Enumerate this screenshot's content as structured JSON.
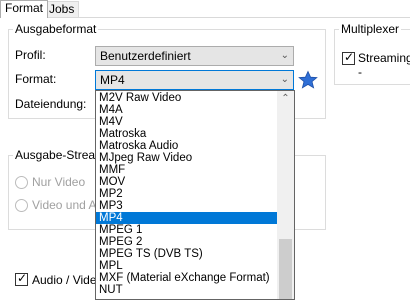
{
  "tabs": [
    {
      "label": "Format"
    },
    {
      "label": "Jobs"
    }
  ],
  "output_format": {
    "title": "Ausgabeformat",
    "profile_label": "Profil:",
    "profile_value": "Benutzerdefiniert",
    "format_label": "Format:",
    "format_value": "MP4",
    "file_ext_label": "Dateiendung:"
  },
  "multiplexer": {
    "title": "Multiplexer",
    "streaming_label": "Streaming -",
    "streaming_checked": true
  },
  "output_stream": {
    "title": "Ausgabe-Stream",
    "only_video_label": "Nur Video",
    "video_audio_label": "Video und Au"
  },
  "audio_video": {
    "label": "Audio / Video",
    "checked": true
  },
  "format_dropdown": {
    "selected": "MP4",
    "items": [
      "M2V Raw Video",
      "M4A",
      "M4V",
      "Matroska",
      "Matroska Audio",
      "MJpeg Raw Video",
      "MMF",
      "MOV",
      "MP2",
      "MP3",
      "MP4",
      "MPEG 1",
      "MPEG 2",
      "MPEG TS (DVB TS)",
      "MPL",
      "MXF (Material eXchange Format)",
      "NUT"
    ]
  },
  "colors": {
    "selection": "#0078d7",
    "star": "#2f6fd6"
  }
}
